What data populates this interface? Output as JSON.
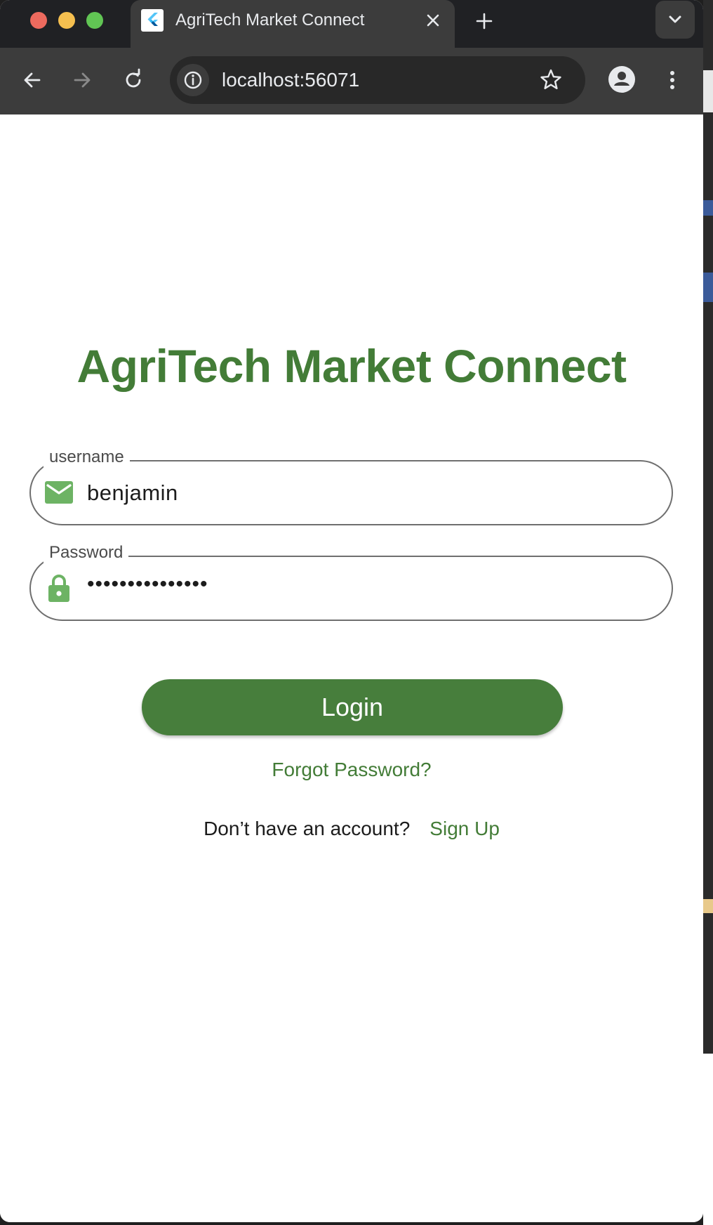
{
  "browser": {
    "tab_title": "AgriTech Market Connect",
    "url": "localhost:56071"
  },
  "app": {
    "title": "AgriTech Market Connect"
  },
  "login_form": {
    "username": {
      "label": "username",
      "value": "benjamin",
      "icon": "mail-icon"
    },
    "password": {
      "label": "Password",
      "value": "•••••••••••••••",
      "icon": "lock-icon"
    },
    "login_label": "Login",
    "forgot_label": "Forgot Password?",
    "no_account_text": "Don’t have an account?",
    "signup_label": "Sign Up"
  },
  "colors": {
    "brand_green": "#437c37",
    "button_green": "#477e3c",
    "icon_green": "#6db364"
  }
}
